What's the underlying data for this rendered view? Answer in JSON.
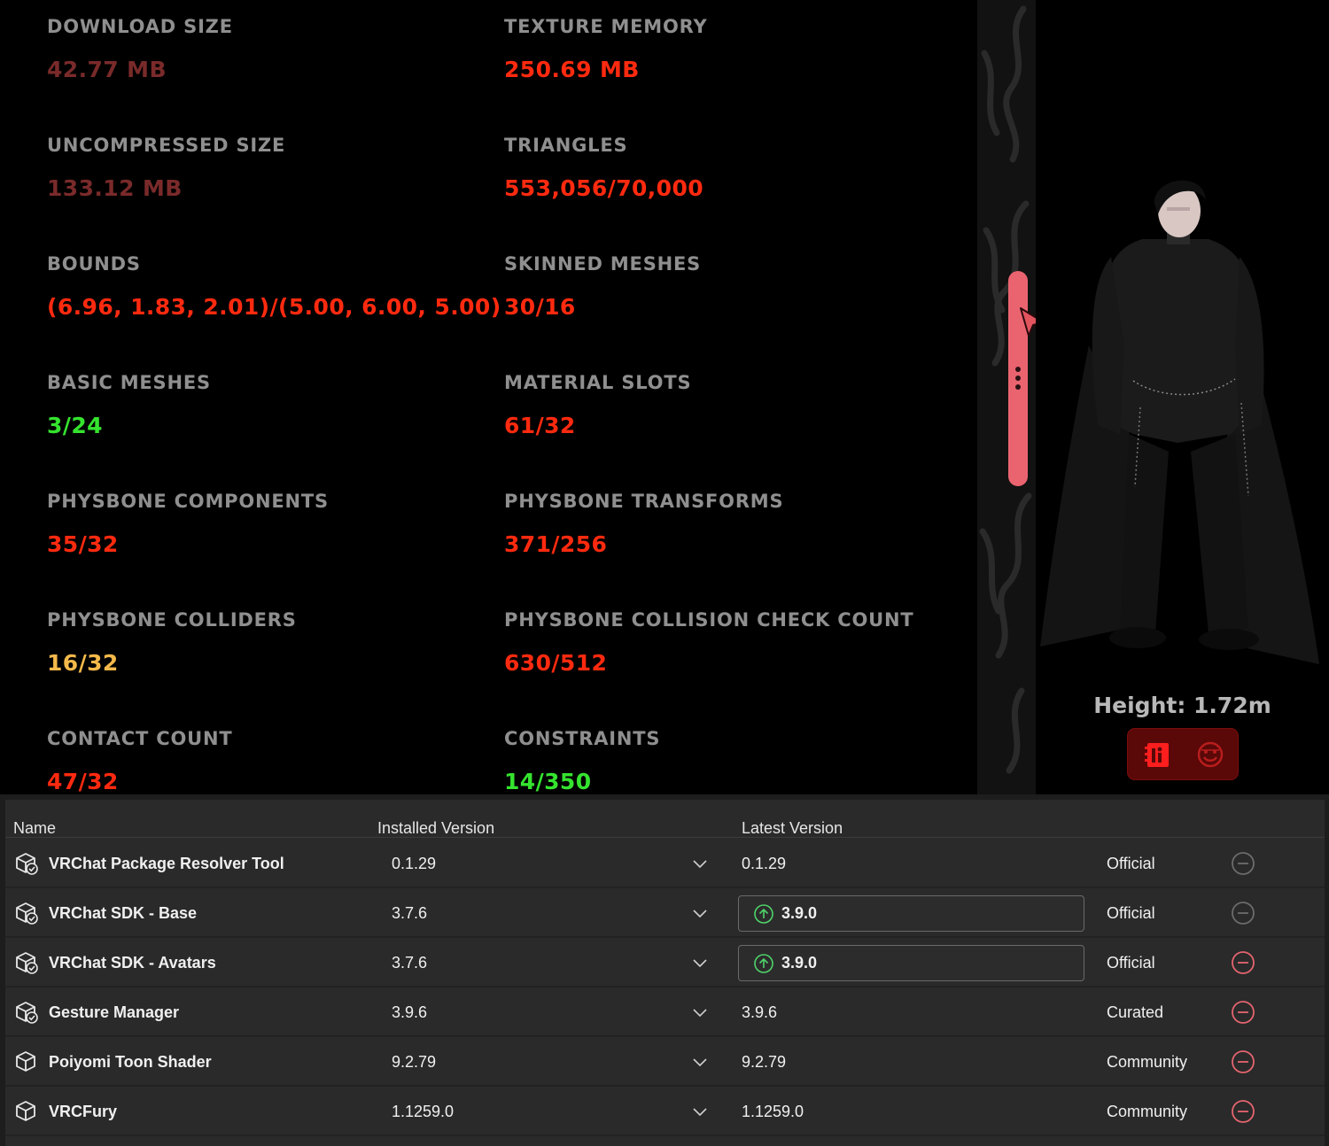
{
  "colors": {
    "bad": "#ff2a0f",
    "dim_bad": "#7a2a2a",
    "good": "#35e32f",
    "warn": "#f4b94a",
    "label": "#8f8f8f",
    "handle": "#ea6470",
    "remove_active": "#e5656f",
    "remove_inactive": "#6c6c6c"
  },
  "stats": [
    {
      "label": "DOWNLOAD SIZE",
      "value": "42.77 MB",
      "status": "dim"
    },
    {
      "label": "TEXTURE MEMORY",
      "value": "250.69 MB",
      "status": "bad"
    },
    {
      "label": "UNCOMPRESSED SIZE",
      "value": "133.12 MB",
      "status": "dim"
    },
    {
      "label": "TRIANGLES",
      "value": "553,056/70,000",
      "status": "bad"
    },
    {
      "label": "BOUNDS",
      "value": "(6.96, 1.83, 2.01)/(5.00, 6.00, 5.00)",
      "status": "bad"
    },
    {
      "label": "SKINNED MESHES",
      "value": "30/16",
      "status": "bad"
    },
    {
      "label": "BASIC MESHES",
      "value": "3/24",
      "status": "good"
    },
    {
      "label": "MATERIAL SLOTS",
      "value": "61/32",
      "status": "bad"
    },
    {
      "label": "PHYSBONE COMPONENTS",
      "value": "35/32",
      "status": "bad"
    },
    {
      "label": "PHYSBONE TRANSFORMS",
      "value": "371/256",
      "status": "bad"
    },
    {
      "label": "PHYSBONE COLLIDERS",
      "value": "16/32",
      "status": "warn"
    },
    {
      "label": "PHYSBONE COLLISION CHECK COUNT",
      "value": "630/512",
      "status": "bad"
    },
    {
      "label": "CONTACT COUNT",
      "value": "47/32",
      "status": "bad"
    },
    {
      "label": "CONSTRAINTS",
      "value": "14/350",
      "status": "good"
    }
  ],
  "avatar": {
    "height_label": "Height: 1.72m",
    "buttons": [
      {
        "icon": "info-card-icon",
        "active": true
      },
      {
        "icon": "emote-icon",
        "active": false
      }
    ]
  },
  "table": {
    "headers": {
      "name": "Name",
      "installed": "Installed Version",
      "latest": "Latest Version"
    },
    "rows": [
      {
        "name": "VRChat Package Resolver Tool",
        "installed": "0.1.29",
        "latest": "0.1.29",
        "update": false,
        "source": "Official",
        "removable": false,
        "icon": "package-check-icon"
      },
      {
        "name": "VRChat SDK - Base",
        "installed": "3.7.6",
        "latest": "3.9.0",
        "update": true,
        "source": "Official",
        "removable": false,
        "icon": "package-check-icon"
      },
      {
        "name": "VRChat SDK - Avatars",
        "installed": "3.7.6",
        "latest": "3.9.0",
        "update": true,
        "source": "Official",
        "removable": true,
        "icon": "package-check-icon"
      },
      {
        "name": "Gesture Manager",
        "installed": "3.9.6",
        "latest": "3.9.6",
        "update": false,
        "source": "Curated",
        "removable": true,
        "icon": "package-check-icon"
      },
      {
        "name": "Poiyomi Toon Shader",
        "installed": "9.2.79",
        "latest": "9.2.79",
        "update": false,
        "source": "Community",
        "removable": true,
        "icon": "package-icon"
      },
      {
        "name": "VRCFury",
        "installed": "1.1259.0",
        "latest": "1.1259.0",
        "update": false,
        "source": "Community",
        "removable": true,
        "icon": "package-icon"
      }
    ]
  }
}
